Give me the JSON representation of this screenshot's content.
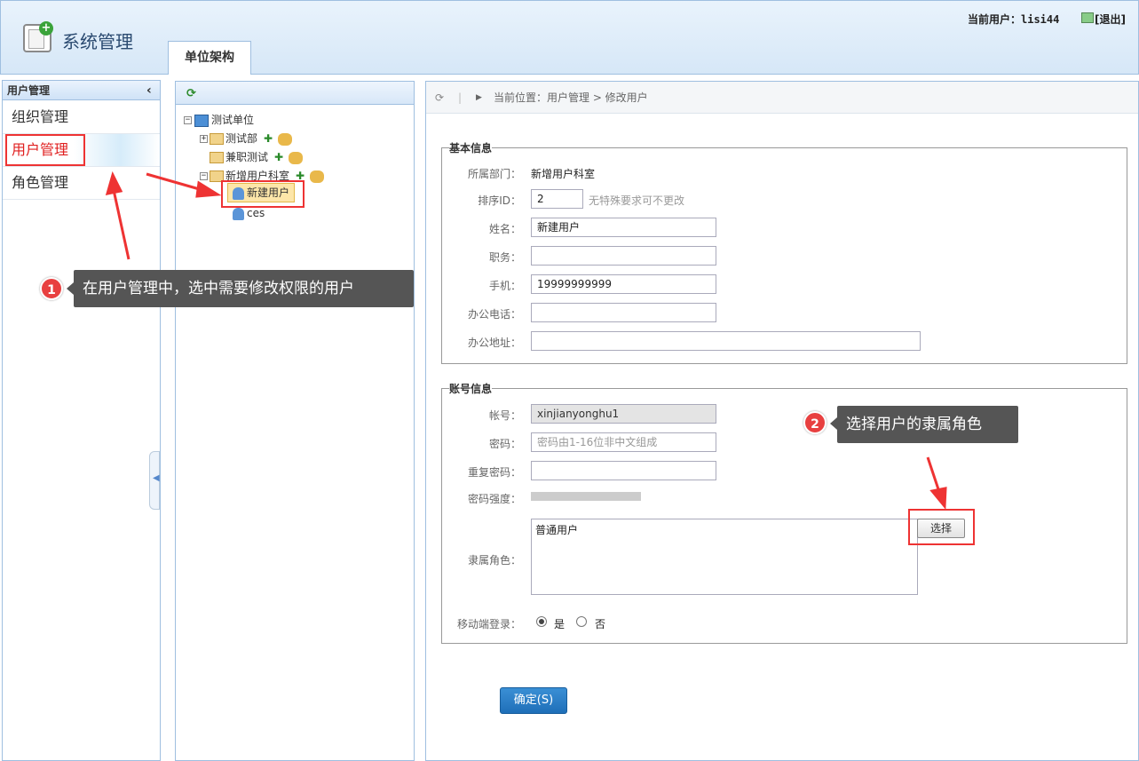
{
  "header": {
    "title": "系统管理",
    "current_user": "当前用户：lisi44",
    "logout": "[退出]",
    "tab": "单位架构"
  },
  "sidebar": {
    "title": "用户管理",
    "items": [
      {
        "label": "组织管理",
        "active": false
      },
      {
        "label": "用户管理",
        "active": true
      },
      {
        "label": "角色管理",
        "active": false
      }
    ]
  },
  "tree": {
    "root": "测试单位",
    "nodes": [
      {
        "label": "测试部"
      },
      {
        "label": "兼职测试"
      },
      {
        "label": "新增用户科室"
      }
    ],
    "users": [
      {
        "label": "新建用户",
        "selected": true
      },
      {
        "label": "ces",
        "selected": false
      }
    ]
  },
  "breadcrumb": "当前位置：用户管理 > 修改用户",
  "basic_info": {
    "legend": "基本信息",
    "dept_label": "所属部门：",
    "dept_value": "新增用户科室",
    "sort_label": "排序ID：",
    "sort_value": "2",
    "sort_hint": "无特殊要求可不更改",
    "name_label": "姓名：",
    "name_value": "新建用户",
    "position_label": "职务：",
    "position_value": "",
    "mobile_label": "手机：",
    "mobile_value": "19999999999",
    "office_phone_label": "办公电话：",
    "office_phone_value": "",
    "office_addr_label": "办公地址：",
    "office_addr_value": ""
  },
  "account_info": {
    "legend": "账号信息",
    "account_label": "帐号：",
    "account_value": "xinjianyonghu1",
    "password_label": "密码：",
    "password_placeholder": "密码由1-16位非中文组成",
    "repeat_label": "重复密码：",
    "strength_label": "密码强度：",
    "role_label": "隶属角色：",
    "role_value": "普通用户",
    "select_button": "选择",
    "mobile_login_label": "移动端登录：",
    "mobile_login_yes": "是",
    "mobile_login_no": "否",
    "mobile_login_selected": "是"
  },
  "confirm_button": "确定(S)",
  "tips": [
    {
      "num": "1",
      "text": "在用户管理中，选中需要修改权限的用户"
    },
    {
      "num": "2",
      "text": "选择用户的隶属角色"
    }
  ]
}
